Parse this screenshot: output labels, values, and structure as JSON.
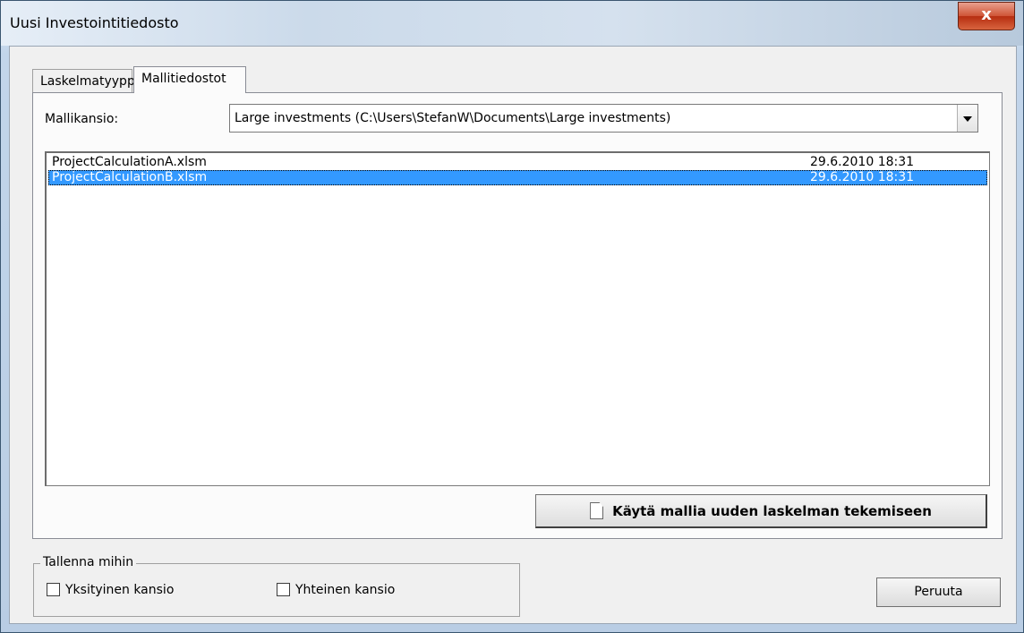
{
  "window": {
    "title": "Uusi Investointitiedosto",
    "close_label": "x"
  },
  "tabs": [
    {
      "label": "Laskelmatyyppi",
      "active": false
    },
    {
      "label": "Mallitiedostot",
      "active": true
    }
  ],
  "folder": {
    "label": "Mallikansio:",
    "selected": "Large investments (C:\\Users\\StefanW\\Documents\\Large investments)"
  },
  "files": [
    {
      "name": "ProjectCalculationA.xlsm",
      "date": "29.6.2010 18:31",
      "selected": false
    },
    {
      "name": "ProjectCalculationB.xlsm",
      "date": "29.6.2010 18:31",
      "selected": true
    }
  ],
  "use_template_button": {
    "label": "Käytä mallia uuden laskelman tekemiseen",
    "icon": "document-icon"
  },
  "save_to": {
    "legend": "Tallenna mihin",
    "options": [
      {
        "label": "Yksityinen kansio",
        "checked": false
      },
      {
        "label": "Yhteinen kansio",
        "checked": false
      }
    ]
  },
  "cancel_button": {
    "label": "Peruuta"
  },
  "colors": {
    "selection": "#3399ff",
    "close": "#c9452a"
  }
}
